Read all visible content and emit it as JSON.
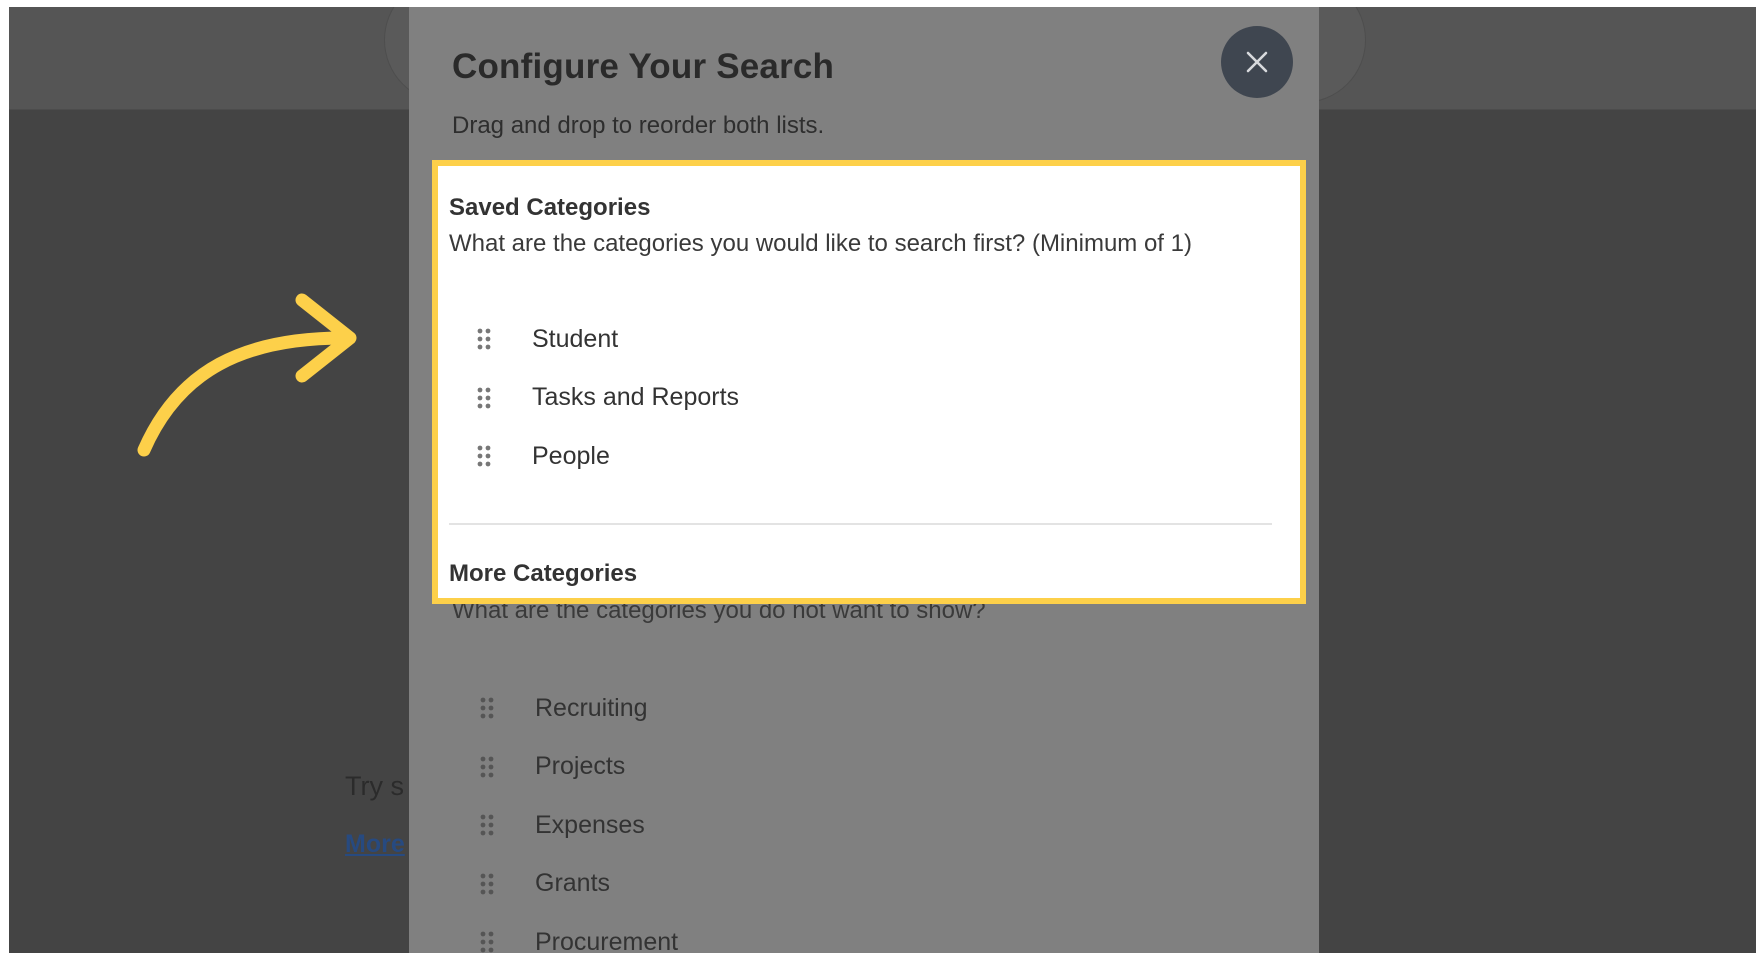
{
  "background_page": {
    "hint_text": "Try s",
    "link_text": "More"
  },
  "modal": {
    "title": "Configure Your Search",
    "subtitle": "Drag and drop to reorder both lists.",
    "close_icon": "close-icon",
    "saved_categories": {
      "heading": "Saved Categories",
      "question": "What are the categories you would like to search first? (Minimum of 1)",
      "items": [
        {
          "label": "Student"
        },
        {
          "label": "Tasks and Reports"
        },
        {
          "label": "People"
        }
      ]
    },
    "more_categories": {
      "heading": "More Categories",
      "question": "What are the categories you do not want to show?",
      "items": [
        {
          "label": "Recruiting"
        },
        {
          "label": "Projects"
        },
        {
          "label": "Expenses"
        },
        {
          "label": "Grants"
        },
        {
          "label": "Procurement"
        }
      ]
    }
  },
  "annotation": {
    "highlight_color": "#fdd04a",
    "arrow_icon": "curved-arrow-icon"
  }
}
